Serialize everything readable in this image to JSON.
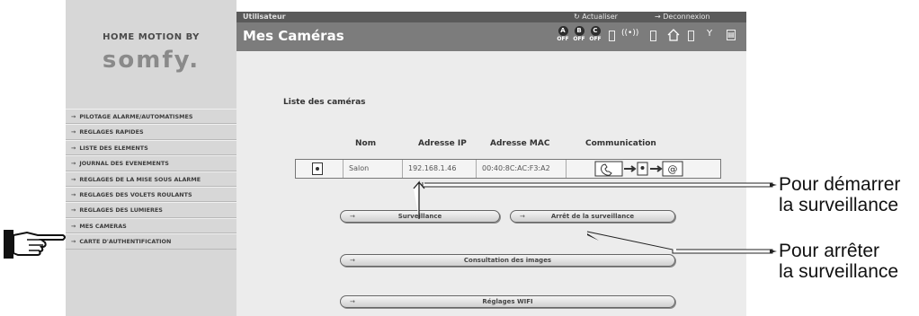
{
  "brand": {
    "top": "HOME MOTION BY",
    "logo": "somfy."
  },
  "sidebar": {
    "items": [
      {
        "label": "PILOTAGE ALARME/AUTOMATISMES"
      },
      {
        "label": "REGLAGES RAPIDES"
      },
      {
        "label": "LISTE DES ELEMENTS"
      },
      {
        "label": "JOURNAL DES EVENEMENTS"
      },
      {
        "label": "REGLAGES DE LA MISE SOUS ALARME"
      },
      {
        "label": "REGLAGES DES VOLETS ROULANTS"
      },
      {
        "label": "REGLAGES DES LUMIERES"
      },
      {
        "label": "MES CAMERAS"
      },
      {
        "label": "CARTE D'AUTHENTIFICATION"
      }
    ]
  },
  "header": {
    "user": "Utilisateur",
    "refresh": "Actualiser",
    "logout": "Deconnexion",
    "title": "Mes Caméras",
    "zones": [
      {
        "letter": "A",
        "state": "OFF"
      },
      {
        "letter": "B",
        "state": "OFF"
      },
      {
        "letter": "C",
        "state": "OFF"
      }
    ]
  },
  "cameras": {
    "title": "Liste des caméras",
    "columns": {
      "name": "Nom",
      "ip": "Adresse IP",
      "mac": "Adresse MAC",
      "comm": "Communication"
    },
    "rows": [
      {
        "name": "Salon",
        "ip": "192.168.1.46",
        "mac": "00:40:8C:AC:F3:A2"
      }
    ]
  },
  "buttons": {
    "surveillance": "Surveillance",
    "stop": "Arrêt de la surveillance",
    "consult": "Consultation des images",
    "wifi": "Réglages WIFI"
  },
  "annotations": {
    "start_line1": "Pour démarrer",
    "start_line2": "la surveillance",
    "stop_line1": "Pour arrêter",
    "stop_line2": "la surveillance"
  }
}
